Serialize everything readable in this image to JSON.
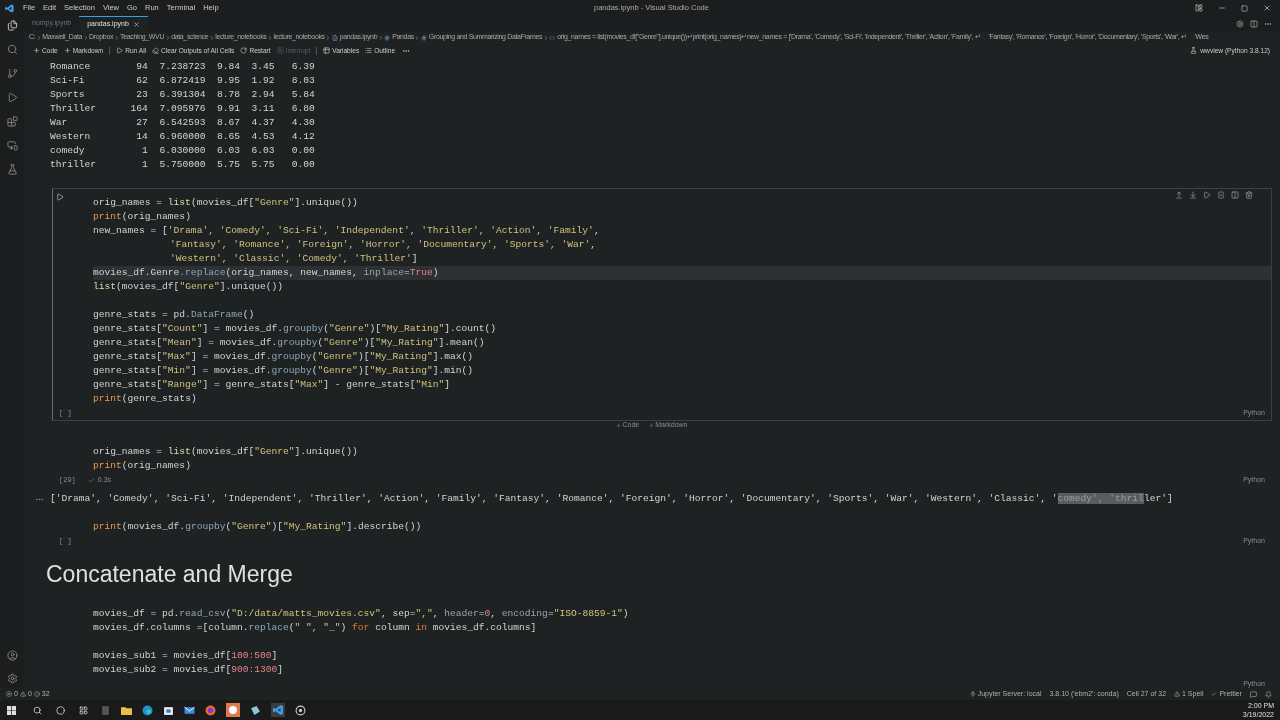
{
  "window": {
    "title": "pandas.ipynb - Visual Studio Code"
  },
  "menu": [
    "File",
    "Edit",
    "Selection",
    "View",
    "Go",
    "Run",
    "Terminal",
    "Help"
  ],
  "tabs": [
    {
      "label": "numpy.ipynb",
      "selected": false
    },
    {
      "label": "pandas.ipynb",
      "selected": true
    }
  ],
  "breadcrumb": [
    {
      "label": "C:",
      "kind": "folder"
    },
    {
      "label": "Maxwell_Data",
      "kind": "folder"
    },
    {
      "label": "Dropbox",
      "kind": "folder"
    },
    {
      "label": "Teaching_WVU",
      "kind": "folder"
    },
    {
      "label": "data_science",
      "kind": "folder"
    },
    {
      "label": "lecture_notebooks",
      "kind": "folder"
    },
    {
      "label": "lecture_notebooks",
      "kind": "folder"
    },
    {
      "label": "pandas.ipynb",
      "kind": "file"
    },
    {
      "label": "Pandas",
      "kind": "heading"
    },
    {
      "label": "Grouping and Summarizing DataFrames",
      "kind": "heading"
    },
    {
      "label": "orig_names = list(movies_df[\"Genre\"].unique())↵print(orig_names)↵new_names = ['Drama', 'Comedy', 'Sci-Fi', 'Independent', 'Thriller', 'Action', 'Family', ↵     'Fantasy', 'Romance', 'Foreign', 'Horror', 'Documentary', 'Sports', 'War', ↵     'Wes",
      "kind": "cell"
    }
  ],
  "toolbar": [
    {
      "label": "Code",
      "kind": "add",
      "disabled": false
    },
    {
      "label": "Markdown",
      "kind": "add",
      "disabled": false
    },
    {
      "label": "Run All",
      "kind": "run",
      "disabled": false
    },
    {
      "label": "Clear Outputs of All Cells",
      "kind": "clear",
      "disabled": false
    },
    {
      "label": "Restart",
      "kind": "restart",
      "disabled": false
    },
    {
      "label": "Interrupt",
      "kind": "interrupt",
      "disabled": true
    },
    {
      "label": "Variables",
      "kind": "variables",
      "disabled": false
    },
    {
      "label": "Outline",
      "kind": "outline",
      "disabled": false
    }
  ],
  "kernel": "wwview (Python 3.8.12)",
  "table_output": [
    "Romance        94  7.238723  9.84  3.45   6.39",
    "Sci-Fi         62  6.872419  9.95  1.92   8.03",
    "Sports         23  6.391304  8.78  2.94   5.84",
    "Thriller      164  7.095976  9.91  3.11   6.80",
    "War            27  6.542593  8.67  4.37   4.30",
    "Western        14  6.960000  8.65  4.53   4.12",
    "comedy          1  6.030000  6.03  6.03   0.00",
    "thriller        1  5.750000  5.75  5.75   0.00"
  ],
  "cells": [
    {
      "kind": "code",
      "selected": true,
      "exec": "[ ]",
      "language": "Python",
      "code_blocks": [
        [
          {
            "highlighted": false,
            "segs": [
              {
                "text": "orig_names = ",
                "kind": "var"
              },
              {
                "text": "list",
                "kind": "fn"
              },
              {
                "text": "(movies_df[",
                "kind": "var"
              },
              {
                "text": "\"Genre\"",
                "kind": "str"
              },
              {
                "text": "].unique())",
                "kind": "var"
              }
            ]
          },
          {
            "highlighted": false,
            "segs": [
              {
                "text": "print",
                "kind": "builtin"
              },
              {
                "text": "(orig_names)",
                "kind": "var"
              }
            ]
          },
          {
            "highlighted": false,
            "segs": [
              {
                "text": "new_names = [",
                "kind": "var"
              },
              {
                "text": "'Drama', 'Comedy', 'Sci-Fi', 'Independent', 'Thriller', 'Action', 'Family'",
                "kind": "str"
              },
              {
                "text": ",",
                "kind": "var"
              }
            ]
          },
          {
            "highlighted": false,
            "continuation": true,
            "segs": [
              {
                "text": "'Fantasy', 'Romance', 'Foreign', 'Horror', 'Documentary', 'Sports', 'War'",
                "kind": "str"
              },
              {
                "text": ",",
                "kind": "var"
              }
            ]
          },
          {
            "highlighted": false,
            "continuation": true,
            "segs": [
              {
                "text": "'Western', 'Classic', 'Comedy', 'Thriller'",
                "kind": "str"
              },
              {
                "text": "]",
                "kind": "var"
              }
            ]
          },
          {
            "highlighted": true,
            "segs": [
              {
                "text": "movies_df.Genre",
                "kind": "var"
              },
              {
                "text": ".replace",
                "kind": "method"
              },
              {
                "text": "(orig_names, new_names, ",
                "kind": "var"
              },
              {
                "text": "inplace",
                "kind": "param"
              },
              {
                "text": "=",
                "kind": "var"
              },
              {
                "text": "True",
                "kind": "const"
              },
              {
                "text": ")",
                "kind": "var"
              }
            ]
          },
          {
            "highlighted": false,
            "segs": [
              {
                "text": "list",
                "kind": "fn"
              },
              {
                "text": "(movies_df[",
                "kind": "var"
              },
              {
                "text": "\"Genre\"",
                "kind": "str"
              },
              {
                "text": "].unique())",
                "kind": "var"
              }
            ]
          }
        ],
        [
          {
            "highlighted": false,
            "segs": [
              {
                "text": "genre_stats = pd.",
                "kind": "var"
              },
              {
                "text": "DataFrame",
                "kind": "method"
              },
              {
                "text": "()",
                "kind": "var"
              }
            ]
          },
          {
            "highlighted": false,
            "segs": [
              {
                "text": "genre_stats[",
                "kind": "var"
              },
              {
                "text": "\"Count\"",
                "kind": "str"
              },
              {
                "text": "] = movies_df.",
                "kind": "var"
              },
              {
                "text": "groupby",
                "kind": "method"
              },
              {
                "text": "(",
                "kind": "var"
              },
              {
                "text": "\"Genre\"",
                "kind": "str"
              },
              {
                "text": ")[",
                "kind": "var"
              },
              {
                "text": "\"My_Rating\"",
                "kind": "str"
              },
              {
                "text": "].count()",
                "kind": "var"
              }
            ]
          },
          {
            "highlighted": false,
            "segs": [
              {
                "text": "genre_stats[",
                "kind": "var"
              },
              {
                "text": "\"Mean\"",
                "kind": "str"
              },
              {
                "text": "] = movies_df.",
                "kind": "var"
              },
              {
                "text": "groupby",
                "kind": "method"
              },
              {
                "text": "(",
                "kind": "var"
              },
              {
                "text": "\"Genre\"",
                "kind": "str"
              },
              {
                "text": ")[",
                "kind": "var"
              },
              {
                "text": "\"My_Rating\"",
                "kind": "str"
              },
              {
                "text": "].mean()",
                "kind": "var"
              }
            ]
          },
          {
            "highlighted": false,
            "segs": [
              {
                "text": "genre_stats[",
                "kind": "var"
              },
              {
                "text": "\"Max\"",
                "kind": "str"
              },
              {
                "text": "] = movies_df.",
                "kind": "var"
              },
              {
                "text": "groupby",
                "kind": "method"
              },
              {
                "text": "(",
                "kind": "var"
              },
              {
                "text": "\"Genre\"",
                "kind": "str"
              },
              {
                "text": ")[",
                "kind": "var"
              },
              {
                "text": "\"My_Rating\"",
                "kind": "str"
              },
              {
                "text": "].max()",
                "kind": "var"
              }
            ]
          },
          {
            "highlighted": false,
            "segs": [
              {
                "text": "genre_stats[",
                "kind": "var"
              },
              {
                "text": "\"Min\"",
                "kind": "str"
              },
              {
                "text": "] = movies_df.",
                "kind": "var"
              },
              {
                "text": "groupby",
                "kind": "method"
              },
              {
                "text": "(",
                "kind": "var"
              },
              {
                "text": "\"Genre\"",
                "kind": "str"
              },
              {
                "text": ")[",
                "kind": "var"
              },
              {
                "text": "\"My_Rating\"",
                "kind": "str"
              },
              {
                "text": "].min()",
                "kind": "var"
              }
            ]
          },
          {
            "highlighted": false,
            "segs": [
              {
                "text": "genre_stats[",
                "kind": "var"
              },
              {
                "text": "\"Range\"",
                "kind": "str"
              },
              {
                "text": "] = genre_stats[",
                "kind": "var"
              },
              {
                "text": "\"Max\"",
                "kind": "str"
              },
              {
                "text": "] - genre_stats[",
                "kind": "var"
              },
              {
                "text": "\"Min\"",
                "kind": "str"
              },
              {
                "text": "]",
                "kind": "var"
              }
            ]
          },
          {
            "highlighted": false,
            "segs": [
              {
                "text": "print",
                "kind": "builtin"
              },
              {
                "text": "(genre_stats)",
                "kind": "var"
              }
            ]
          }
        ]
      ]
    },
    {
      "kind": "insert",
      "buttons": [
        "Code",
        "Markdown"
      ]
    },
    {
      "kind": "code",
      "selected": false,
      "exec": "[29]",
      "duration": "0.3s",
      "language": "Python",
      "code_blocks": [
        [
          {
            "highlighted": false,
            "segs": [
              {
                "text": "orig_names = ",
                "kind": "var"
              },
              {
                "text": "list",
                "kind": "fn"
              },
              {
                "text": "(movies_df[",
                "kind": "var"
              },
              {
                "text": "\"Genre\"",
                "kind": "str"
              },
              {
                "text": "].unique())",
                "kind": "var"
              }
            ]
          },
          {
            "highlighted": false,
            "segs": [
              {
                "text": "print",
                "kind": "builtin"
              },
              {
                "text": "(orig_names)",
                "kind": "var"
              }
            ]
          }
        ]
      ],
      "output": [
        {
          "text": "['Drama', 'Comedy', 'Sci-Fi', 'Independent', 'Thriller', 'Action', 'Family', 'Fantasy', 'Romance', 'Foreign', 'Horror', 'Documentary', 'Sports', 'War', 'Western', 'Classic', '",
          "selected": false
        },
        {
          "text": "comedy', 'thril",
          "selected": true
        },
        {
          "text": "ler']",
          "selected": false
        }
      ]
    },
    {
      "kind": "code",
      "selected": false,
      "exec": "[ ]",
      "language": "Python",
      "code_blocks": [
        [
          {
            "highlighted": false,
            "segs": [
              {
                "text": "print",
                "kind": "builtin"
              },
              {
                "text": "(movies_df.",
                "kind": "var"
              },
              {
                "text": "groupby",
                "kind": "method"
              },
              {
                "text": "(",
                "kind": "var"
              },
              {
                "text": "\"Genre\"",
                "kind": "str"
              },
              {
                "text": ")[",
                "kind": "var"
              },
              {
                "text": "\"My_Rating\"",
                "kind": "str"
              },
              {
                "text": "].describe())",
                "kind": "var"
              }
            ]
          }
        ]
      ]
    },
    {
      "kind": "markdown",
      "heading": "Concatenate and Merge"
    },
    {
      "kind": "code",
      "selected": false,
      "language": "Python",
      "code_blocks": [
        [
          {
            "highlighted": false,
            "segs": [
              {
                "text": "movies_df = pd.",
                "kind": "var"
              },
              {
                "text": "read_csv",
                "kind": "method"
              },
              {
                "text": "(",
                "kind": "var"
              },
              {
                "text": "\"D:/data/matts_movies.csv\"",
                "kind": "str"
              },
              {
                "text": ", sep=",
                "kind": "var"
              },
              {
                "text": "\",\"",
                "kind": "str"
              },
              {
                "text": ", ",
                "kind": "var"
              },
              {
                "text": "header",
                "kind": "param"
              },
              {
                "text": "=",
                "kind": "var"
              },
              {
                "text": "0",
                "kind": "num"
              },
              {
                "text": ", ",
                "kind": "var"
              },
              {
                "text": "encoding",
                "kind": "param"
              },
              {
                "text": "=",
                "kind": "var"
              },
              {
                "text": "\"ISO-8859-1\"",
                "kind": "str"
              },
              {
                "text": ")",
                "kind": "var"
              }
            ]
          },
          {
            "highlighted": false,
            "segs": [
              {
                "text": "movies_df.columns =[column.",
                "kind": "var"
              },
              {
                "text": "replace",
                "kind": "method"
              },
              {
                "text": "(",
                "kind": "var"
              },
              {
                "text": "\" \", \"_\"",
                "kind": "str"
              },
              {
                "text": ") ",
                "kind": "var"
              },
              {
                "text": "for",
                "kind": "kw"
              },
              {
                "text": " column ",
                "kind": "var"
              },
              {
                "text": "in",
                "kind": "kw"
              },
              {
                "text": " movies_df.columns]",
                "kind": "var"
              }
            ]
          }
        ],
        [
          {
            "highlighted": false,
            "segs": [
              {
                "text": "movies_sub1 = movies_df[",
                "kind": "var"
              },
              {
                "text": "100:500",
                "kind": "num"
              },
              {
                "text": "]",
                "kind": "var"
              }
            ]
          },
          {
            "highlighted": false,
            "segs": [
              {
                "text": "movies_sub2 = movies_df[",
                "kind": "var"
              },
              {
                "text": "900:1300",
                "kind": "num"
              },
              {
                "text": "]",
                "kind": "var"
              }
            ]
          }
        ]
      ]
    }
  ],
  "status_bar": {
    "errors": "0",
    "warnings": "0",
    "infos": "32",
    "items": [
      {
        "label": "Jupyter Server: local",
        "kind": "server"
      },
      {
        "label": "3.8.10 ('ebm2': conda)",
        "kind": "plain"
      },
      {
        "label": "Cell 27 of 32",
        "kind": "plain"
      },
      {
        "label": "1 Spell",
        "kind": "warning"
      },
      {
        "label": "Prettier",
        "kind": "check"
      }
    ]
  },
  "taskbar": {
    "time": "2:00 PM",
    "date": "3/19/2022"
  }
}
